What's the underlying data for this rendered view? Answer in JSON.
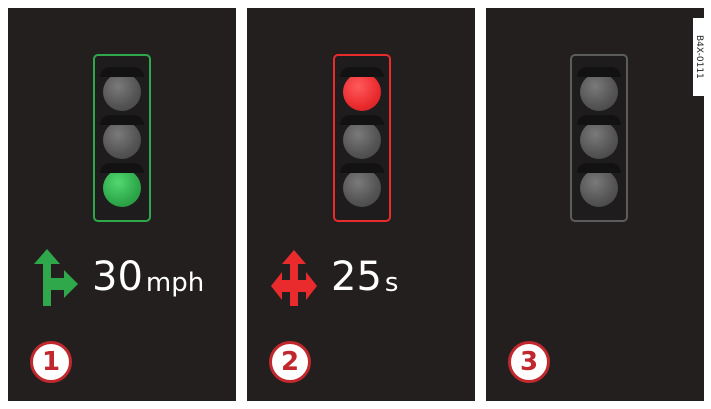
{
  "colors": {
    "panel_background": "#231f1f",
    "green": "#2ea84a",
    "red": "#ea2b2e",
    "inactive_frame": "#5c5c5c",
    "lamp_off": "#565656",
    "callout_red": "#c0282d"
  },
  "panels": [
    {
      "callout": "1",
      "signal": {
        "active_lamp": "bottom",
        "active_color": "green",
        "frame_color": "green"
      },
      "icon": "green-go-straight-or-right-arrow-icon",
      "value": "30",
      "unit": "mph"
    },
    {
      "callout": "2",
      "signal": {
        "active_lamp": "top",
        "active_color": "red",
        "frame_color": "red"
      },
      "icon": "red-four-way-arrow-icon",
      "value": "25",
      "unit": "s"
    },
    {
      "callout": "3",
      "signal": {
        "active_lamp": "none",
        "active_color": "none",
        "frame_color": "gray"
      }
    }
  ],
  "reference_code": "B4X-0111"
}
